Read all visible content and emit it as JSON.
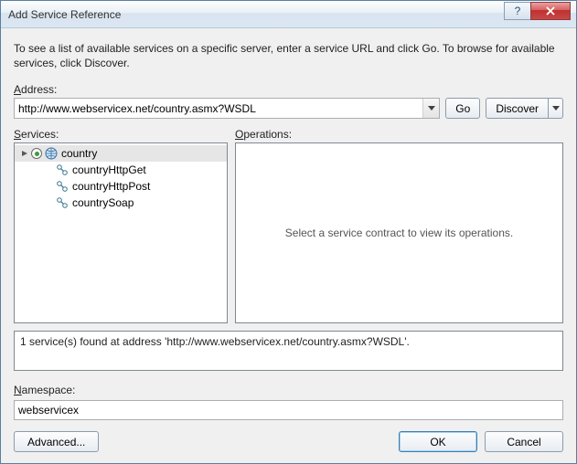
{
  "window": {
    "title": "Add Service Reference"
  },
  "instruction": "To see a list of available services on a specific server, enter a service URL and click Go. To browse for available services, click Discover.",
  "labels": {
    "address": "Address:",
    "services": "Services:",
    "operations": "Operations:",
    "namespace": "Namespace:"
  },
  "address": {
    "value": "http://www.webservicex.net/country.asmx?WSDL"
  },
  "buttons": {
    "go": "Go",
    "discover": "Discover",
    "advanced": "Advanced...",
    "ok": "OK",
    "cancel": "Cancel"
  },
  "services_tree": {
    "root": {
      "label": "country",
      "expanded": true,
      "selected": true
    },
    "children": [
      {
        "label": "countryHttpGet"
      },
      {
        "label": "countryHttpPost"
      },
      {
        "label": "countrySoap"
      }
    ]
  },
  "operations_placeholder": "Select a service contract to view its operations.",
  "status": "1 service(s) found at address 'http://www.webservicex.net/country.asmx?WSDL'.",
  "namespace": {
    "value": "webservicex"
  }
}
